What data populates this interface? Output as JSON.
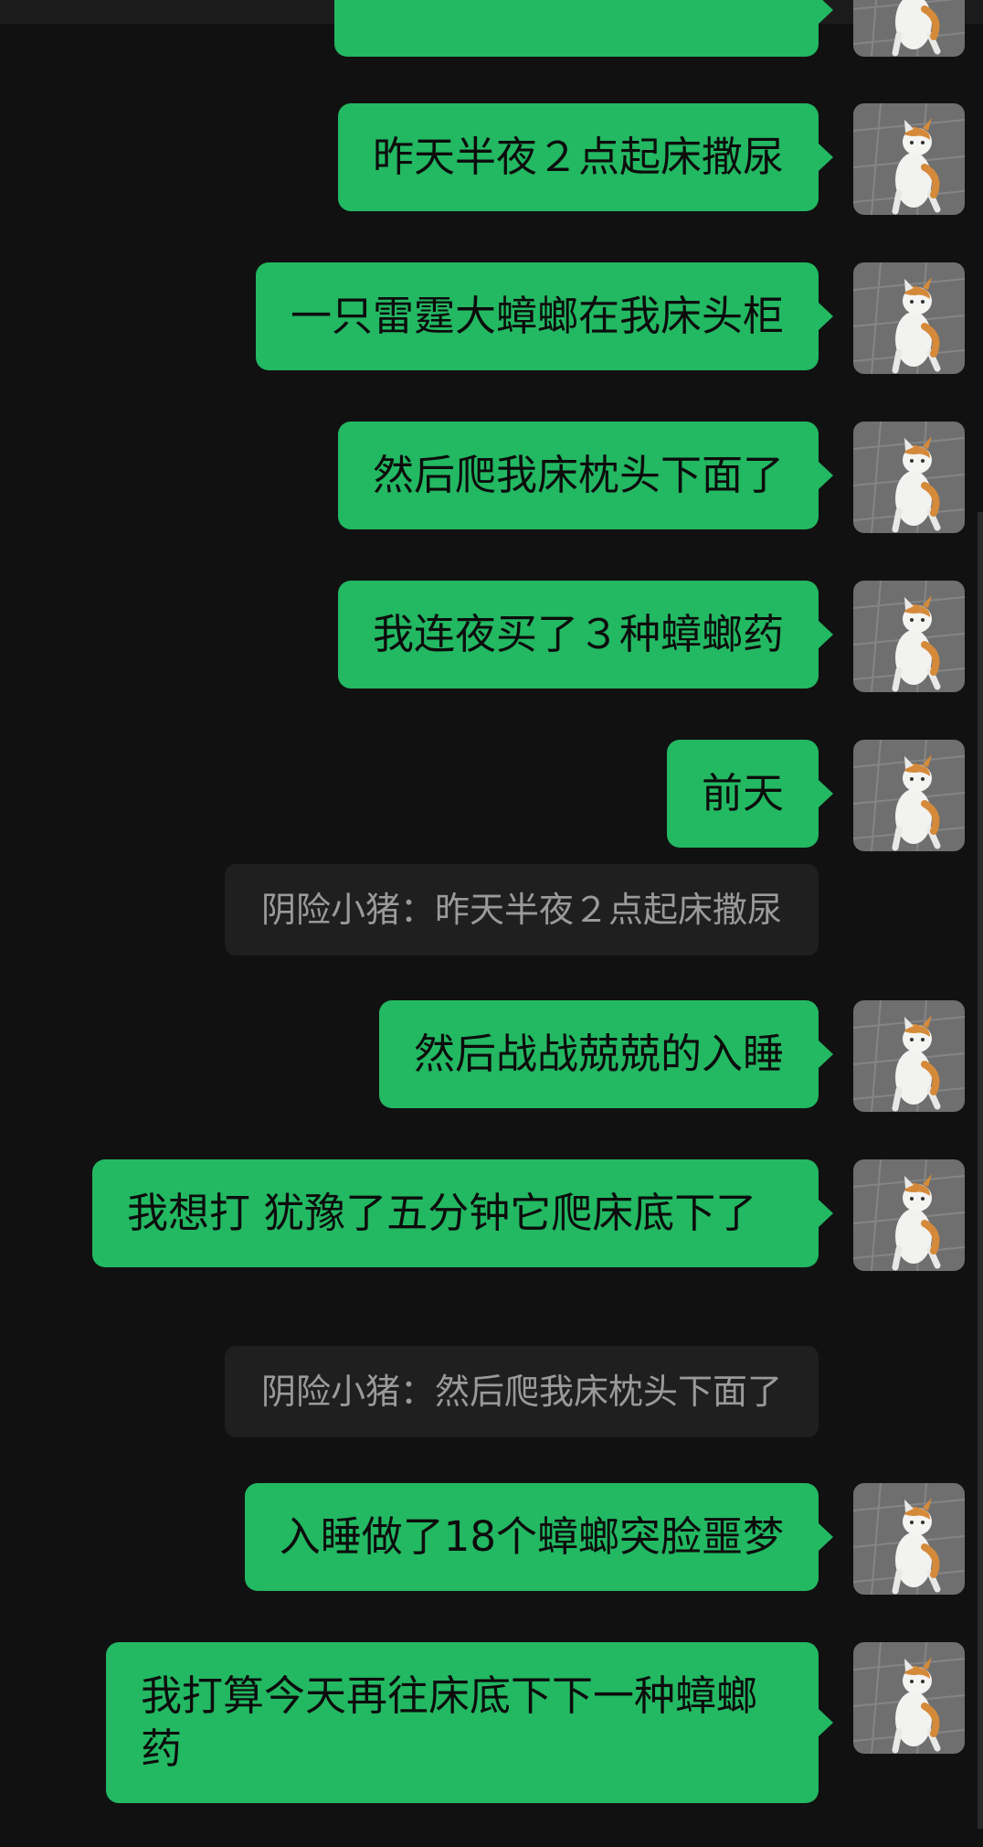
{
  "messages": [
    {
      "type": "bubble",
      "text": "昨天半夜２点起床撒尿"
    },
    {
      "type": "bubble",
      "text": "一只雷霆大蟑螂在我床头柜"
    },
    {
      "type": "bubble",
      "text": "然后爬我床枕头下面了"
    },
    {
      "type": "bubble",
      "text": "我连夜买了３种蟑螂药"
    },
    {
      "type": "bubble",
      "text": "前天"
    },
    {
      "type": "quote",
      "text": "阴险小猪：昨天半夜２点起床撒尿"
    },
    {
      "type": "bubble",
      "text": "然后战战兢兢的入睡"
    },
    {
      "type": "bubble",
      "text": "我想打 犹豫了五分钟它爬床底下了"
    },
    {
      "type": "quote",
      "text": "阴险小猪：然后爬我床枕头下面了"
    },
    {
      "type": "bubble",
      "text": "入睡做了18个蟑螂突脸噩梦"
    },
    {
      "type": "bubble",
      "text": "我打算今天再往床底下下一种蟑螂药"
    }
  ],
  "avatar": {
    "icon": "cat-avatar-icon"
  },
  "colors": {
    "background": "#111111",
    "bubble": "#23b862",
    "quote_bg": "#1f1f1f",
    "quote_text": "#9a9a9a"
  }
}
